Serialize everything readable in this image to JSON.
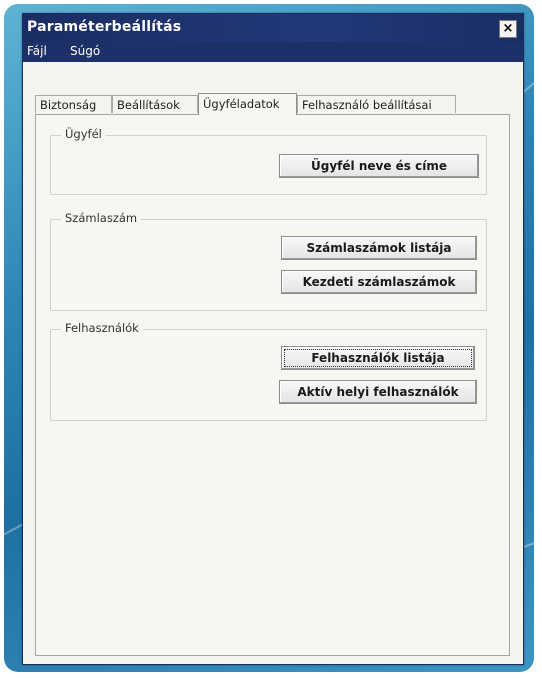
{
  "window": {
    "title": "Paraméterbeállítás",
    "close_glyph": "×"
  },
  "menu": {
    "items": [
      "Fájl",
      "Súgó"
    ]
  },
  "tabs": [
    {
      "label": "Biztonság",
      "active": false
    },
    {
      "label": "Beállítások",
      "active": false
    },
    {
      "label": "Ügyféladatok",
      "active": true
    },
    {
      "label": "Felhasználó beállításai",
      "active": false
    }
  ],
  "groups": {
    "customer": {
      "legend": "Ügyfél",
      "buttons": [
        "Ügyfél neve és címe"
      ]
    },
    "invoice": {
      "legend": "Számlaszám",
      "buttons": [
        "Számlaszámok listája",
        "Kezdeti számlaszámok"
      ]
    },
    "users": {
      "legend": "Felhasználók",
      "buttons": [
        "Felhasználók listája",
        "Aktív helyi felhasználók"
      ]
    }
  },
  "colors": {
    "titlebar": "#1a2d63",
    "window_bg": "#f4f3ee",
    "backdrop": "#2f86b6"
  }
}
